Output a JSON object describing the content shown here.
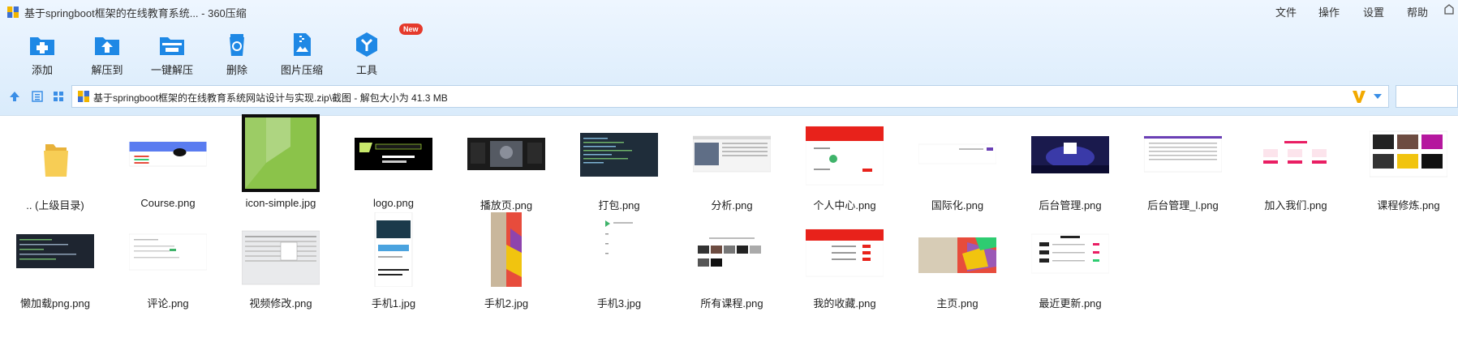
{
  "window": {
    "title": "基于springboot框架的在线教育系统... - 360压缩"
  },
  "menu": {
    "file": "文件",
    "operate": "操作",
    "settings": "设置",
    "help": "帮助"
  },
  "toolbar": {
    "add": "添加",
    "extract_to": "解压到",
    "one_click_extract": "一键解压",
    "delete": "删除",
    "image_compress": "图片压缩",
    "tools": "工具",
    "tools_badge": "New"
  },
  "pathbar": {
    "path": "基于springboot框架的在线教育系统网站设计与实现.zip\\截图 - 解包大小为 41.3 MB"
  },
  "colors": {
    "accent": "#1e88e5",
    "folder": "#f5c542",
    "badge": "#e53a2c",
    "path_logo": "#f2a900"
  },
  "files": [
    {
      "name": ".. (上级目录)",
      "kind": "folder-icon"
    },
    {
      "name": "Course.png",
      "kind": "web-blue"
    },
    {
      "name": "icon-simple.jpg",
      "kind": "green-icon"
    },
    {
      "name": "logo.png",
      "kind": "logo-black"
    },
    {
      "name": "播放页.png",
      "kind": "dark-video"
    },
    {
      "name": "打包.png",
      "kind": "dark-code"
    },
    {
      "name": "分析.png",
      "kind": "analysis"
    },
    {
      "name": "个人中心.png",
      "kind": "red-profile"
    },
    {
      "name": "国际化.png",
      "kind": "white-page"
    },
    {
      "name": "后台管理.png",
      "kind": "dark-stage"
    },
    {
      "name": "后台管理_l.png",
      "kind": "admin-table"
    },
    {
      "name": "加入我们.png",
      "kind": "pink-cards"
    },
    {
      "name": "课程修炼.png",
      "kind": "course-grid"
    },
    {
      "name": "懒加载png.png",
      "kind": "dark-code-2"
    },
    {
      "name": "评论.png",
      "kind": "white-comment"
    },
    {
      "name": "视频修改.png",
      "kind": "form-grey"
    },
    {
      "name": "手机1.jpg",
      "kind": "phone-1"
    },
    {
      "name": "手机2.jpg",
      "kind": "phone-2"
    },
    {
      "name": "手机3.jpg",
      "kind": "phone-3"
    },
    {
      "name": "所有课程.png",
      "kind": "all-courses"
    },
    {
      "name": "我的收藏.png",
      "kind": "red-list"
    },
    {
      "name": "主页.png",
      "kind": "home-colorful"
    },
    {
      "name": "最近更新.png",
      "kind": "updates-list"
    }
  ]
}
